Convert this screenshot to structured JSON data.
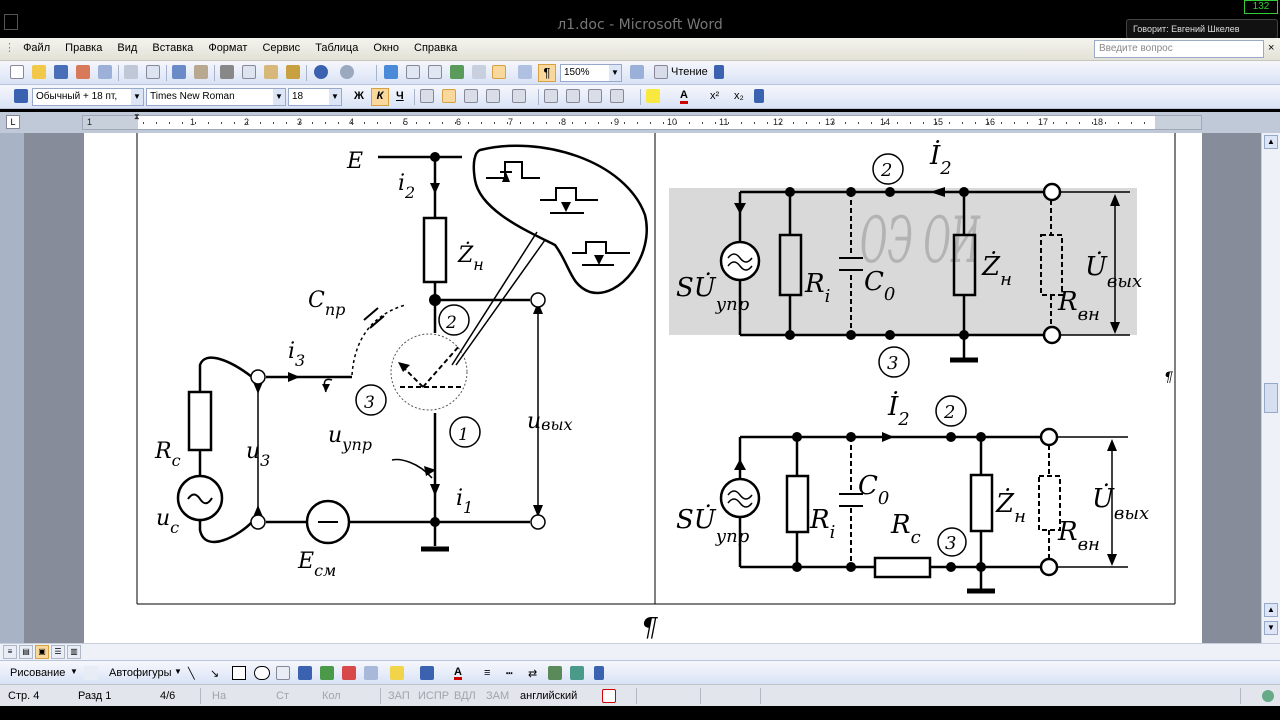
{
  "window": {
    "title": "л1.doc - Microsoft Word",
    "speaker_tooltip": "Говорит: Евгений Шкелев",
    "corner_badge": "132"
  },
  "menubar": {
    "items": [
      "Файл",
      "Правка",
      "Вид",
      "Вставка",
      "Формат",
      "Сервис",
      "Таблица",
      "Окно",
      "Справка"
    ],
    "ask_placeholder": "Введите вопрос",
    "close": "×"
  },
  "toolbar_standard": {
    "zoom": "150%",
    "reading_label": "Чтение",
    "pilcrow": "¶"
  },
  "toolbar_formatting": {
    "style": "Обычный + 18 пт,",
    "font": "Times New Roman",
    "size": "18",
    "bold": "Ж",
    "italic": "К",
    "underline": "Ч",
    "superscript": "x²",
    "subscript": "x₂",
    "font_color_letter": "A"
  },
  "ruler": {
    "numbers": [
      "1",
      "1",
      "2",
      "3",
      "4",
      "5",
      "6",
      "7",
      "8",
      "9",
      "10",
      "11",
      "12",
      "13",
      "14",
      "15",
      "16",
      "17",
      "18"
    ],
    "tab_glyph": "L"
  },
  "diagram": {
    "left": {
      "E": "E",
      "i2": "i",
      "i2_sub": "2",
      "Zn": "Ż",
      "Zn_sub": "н",
      "Cpr": "C",
      "Cpr_sub": "пр",
      "i3": "i",
      "i3_sub": "3",
      "node2": "2",
      "node3": "3",
      "node1": "1",
      "Rc": "R",
      "Rc_sub": "с",
      "u3": "u",
      "u3_sub": "3",
      "uupr": "u",
      "uupr_sub": "упр",
      "uvyh": "u",
      "uvyh_sub": "вых",
      "i1": "i",
      "i1_sub": "1",
      "uc": "u",
      "uc_sub": "с",
      "Esm": "E",
      "Esm_sub": "см"
    },
    "right_top": {
      "I2": "İ",
      "I2_sub": "2",
      "node2": "2",
      "node3": "3",
      "SU": "SU̇",
      "SU_sub": "упр",
      "Ri": "R",
      "Ri_sub": "i",
      "C0": "C",
      "C0_sub": "0",
      "Zn": "Ż",
      "Zn_sub": "н",
      "U": "U̇",
      "U_sub": "вых",
      "Rvn": "R",
      "Rvn_sub": "вн",
      "watermark": "ОЭ ОИ"
    },
    "right_bottom": {
      "I2": "İ",
      "I2_sub": "2",
      "node2": "2",
      "node3": "3",
      "SU": "SU̇",
      "SU_sub": "упр",
      "Ri": "R",
      "Ri_sub": "i",
      "C0": "C",
      "C0_sub": "0",
      "Rc": "R",
      "Rc_sub": "с",
      "Zn": "Ż",
      "Zn_sub": "н",
      "U": "U̇",
      "U_sub": "вых",
      "Rvn": "R",
      "Rvn_sub": "вн"
    },
    "pilcrow": "¶"
  },
  "drawing_toolbar": {
    "drawing": "Рисование",
    "autoshapes": "Автофигуры"
  },
  "statusbar": {
    "page": "Стр. 4",
    "section": "Разд 1",
    "pages": "4/6",
    "at": "На",
    "line": "Ст",
    "col": "Кол",
    "rec": "ЗАП",
    "trk": "ИСПР",
    "ext": "ВДЛ",
    "ovr": "ЗАМ",
    "language": "английский"
  },
  "colors": {
    "toolbar_top": "#f6f7fc",
    "toolbar_bottom": "#d9e3f6",
    "doc_background": "#868c9a",
    "watermark_box": "#d9d9d9"
  }
}
